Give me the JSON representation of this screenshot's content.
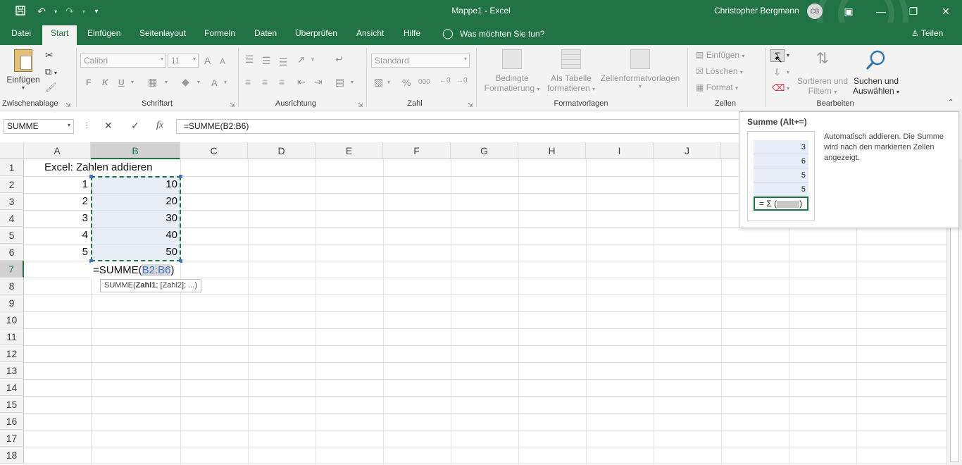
{
  "titlebar": {
    "title": "Mappe1  -  Excel",
    "user": "Christopher Bergmann",
    "initials": "CB",
    "qat_icons": [
      "save-icon",
      "undo-icon",
      "redo-icon",
      "customize-icon"
    ],
    "win_icons": [
      "ribbon-display-icon",
      "minimize-icon",
      "restore-icon",
      "close-icon"
    ],
    "accent": "#217346"
  },
  "tabs": {
    "items": [
      "Datei",
      "Start",
      "Einfügen",
      "Seitenlayout",
      "Formeln",
      "Daten",
      "Überprüfen",
      "Ansicht",
      "Hilfe"
    ],
    "active": "Start",
    "tellme": "Was möchten Sie tun?",
    "share": "Teilen"
  },
  "ribbon": {
    "clipboard": {
      "paste": "Einfügen",
      "label": "Zwischenablage"
    },
    "font": {
      "name": "Calibri",
      "size": "11",
      "bold": "F",
      "italic": "K",
      "underline": "U",
      "grow": "A",
      "shrink": "A",
      "color": "A",
      "label": "Schriftart"
    },
    "alignment": {
      "label": "Ausrichtung"
    },
    "number": {
      "format": "Standard",
      "percent": "%",
      "thousands": "000",
      "label": "Zahl"
    },
    "styles": {
      "conditional": [
        "Bedingte",
        "Formatierung"
      ],
      "table": [
        "Als Tabelle",
        "formatieren"
      ],
      "cellstyles": "Zellenformatvorlagen",
      "label": "Formatvorlagen"
    },
    "cells": {
      "insert": "Einfügen",
      "delete": "Löschen",
      "format": "Format",
      "label": "Zellen"
    },
    "editing": {
      "sort": [
        "Sortieren und",
        "Filtern"
      ],
      "find": [
        "Suchen und",
        "Auswählen"
      ],
      "label": "Bearbeiten"
    }
  },
  "formulabar": {
    "namebox": "SUMME",
    "cancel": "✕",
    "enter": "✓",
    "fx": "fx",
    "formula": "=SUMME(B2:B6)"
  },
  "grid": {
    "columns": [
      "A",
      "B",
      "C",
      "D",
      "E",
      "F",
      "G",
      "H",
      "I",
      "J"
    ],
    "rows": [
      "1",
      "2",
      "3",
      "4",
      "5",
      "6",
      "7",
      "8",
      "9",
      "10",
      "11",
      "12",
      "13",
      "14",
      "15",
      "16",
      "17",
      "18"
    ],
    "a1": "Excel: Zahlen addieren",
    "col_a": [
      "1",
      "2",
      "3",
      "4",
      "5"
    ],
    "col_b": [
      "10",
      "20",
      "30",
      "40",
      "50"
    ],
    "b7_prefix": "=SUMME(",
    "b7_ref": "B2:B6",
    "b7_suffix": ")",
    "syntax_tip_fn": "SUMME(",
    "syntax_tip_arg": "Zahl1",
    "syntax_tip_rest": "; [Zahl2]; ...)"
  },
  "sum_tooltip": {
    "title": "Summe (Alt+=)",
    "description": "Automatisch addieren. Die Summe wird nach den markierten Zellen angezeigt.",
    "example_values": [
      "3",
      "6",
      "5",
      "5"
    ],
    "example_formula": "= Σ (",
    "example_close": ")"
  }
}
